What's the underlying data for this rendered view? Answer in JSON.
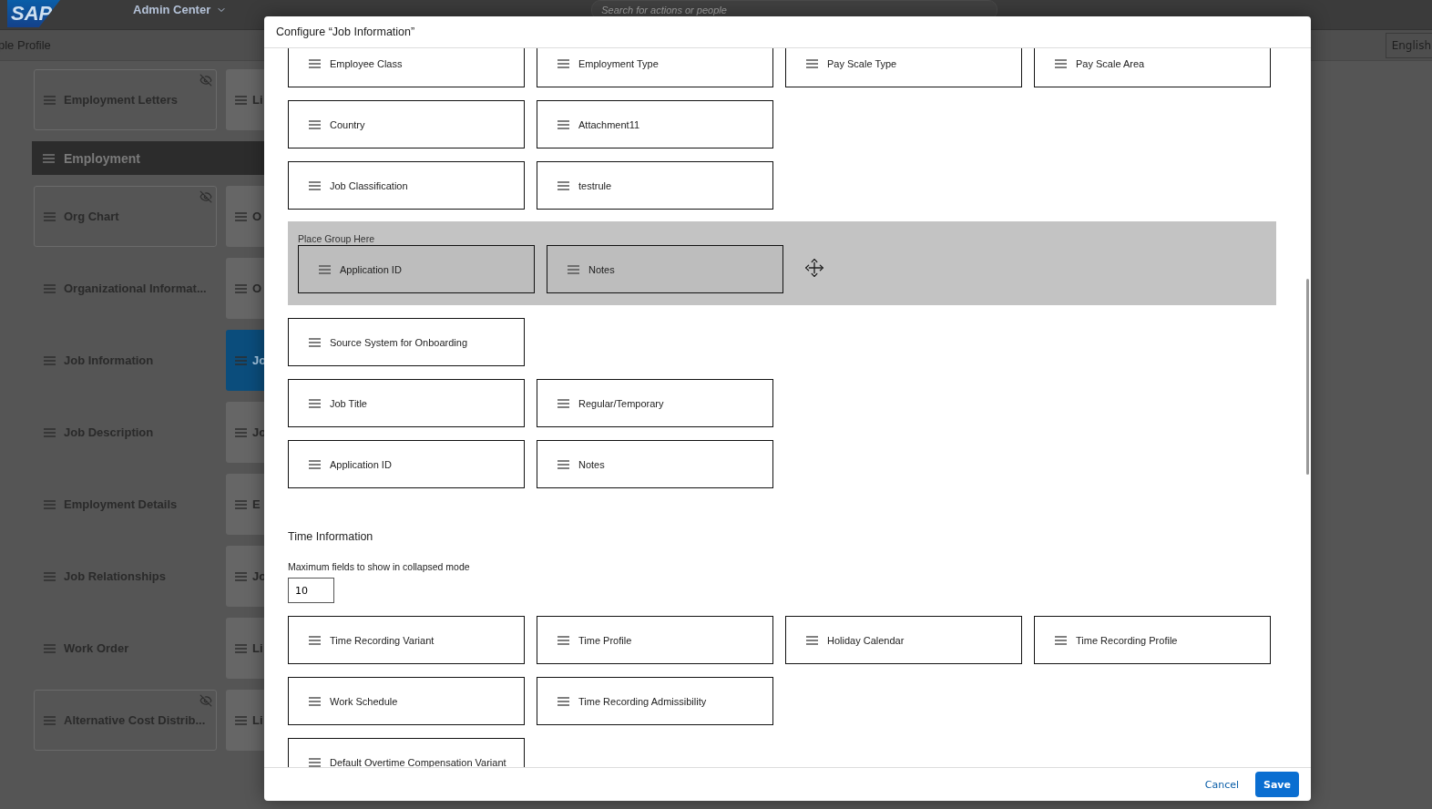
{
  "header": {
    "logo": "SAP",
    "app_title": "Admin Center",
    "search_placeholder": "Search for actions or people"
  },
  "subheader": {
    "title": "ple Profile",
    "language": "English"
  },
  "background_rows": [
    {
      "kind": "cards",
      "left": {
        "label": "Employment Letters",
        "hidden": true
      },
      "right": {
        "label": "Li",
        "selected": false
      }
    },
    {
      "kind": "section",
      "label": "Employment"
    },
    {
      "kind": "cards",
      "left": {
        "label": "Org Chart",
        "hidden": true
      },
      "right": {
        "label": "O",
        "selected": false
      }
    },
    {
      "kind": "cards",
      "left": {
        "label": "Organizational Informat...",
        "hidden": false
      },
      "right": {
        "label": "O",
        "selected": false
      }
    },
    {
      "kind": "cards",
      "left": {
        "label": "Job Information",
        "hidden": false
      },
      "right": {
        "label": "Jo",
        "selected": true
      }
    },
    {
      "kind": "cards",
      "left": {
        "label": "Job Description",
        "hidden": false
      },
      "right": {
        "label": "Jo",
        "selected": false
      }
    },
    {
      "kind": "cards",
      "left": {
        "label": "Employment Details",
        "hidden": false
      },
      "right": {
        "label": "E",
        "selected": false
      }
    },
    {
      "kind": "cards",
      "left": {
        "label": "Job Relationships",
        "hidden": false
      },
      "right": {
        "label": "Jo",
        "selected": false
      }
    },
    {
      "kind": "cards",
      "left": {
        "label": "Work Order",
        "hidden": false
      },
      "right": {
        "label": "Li",
        "selected": false
      }
    },
    {
      "kind": "cards",
      "left": {
        "label": "Alternative Cost Distrib...",
        "hidden": true
      },
      "right": {
        "label": "Li",
        "selected": false
      }
    }
  ],
  "dialog": {
    "title": "Configure “Job Information”",
    "blocks": [
      {
        "kind": "row",
        "fields": [
          "Employee Class",
          "Employment Type",
          "Pay Scale Type",
          "Pay Scale Area"
        ]
      },
      {
        "kind": "row",
        "fields": [
          "Country",
          "Attachment11"
        ]
      },
      {
        "kind": "row",
        "fields": [
          "Job Classification",
          "testrule"
        ]
      },
      {
        "kind": "dropzone",
        "label": "Place Group Here",
        "fields": [
          "Application ID",
          "Notes"
        ]
      },
      {
        "kind": "row",
        "fields": [
          "Source System for Onboarding"
        ]
      },
      {
        "kind": "row",
        "fields": [
          "Job Title",
          "Regular/Temporary"
        ]
      },
      {
        "kind": "row",
        "fields": [
          "Application ID",
          "Notes"
        ]
      },
      {
        "kind": "heading",
        "label": "Time Information"
      },
      {
        "kind": "max_fields",
        "label": "Maximum fields to show in collapsed mode",
        "value": "10"
      },
      {
        "kind": "row",
        "fields": [
          "Time Recording Variant",
          "Time Profile",
          "Holiday Calendar",
          "Time Recording Profile"
        ]
      },
      {
        "kind": "row",
        "fields": [
          "Work Schedule",
          "Time Recording Admissibility"
        ]
      },
      {
        "kind": "row",
        "fields": [
          "Default Overtime Compensation Variant"
        ]
      }
    ],
    "buttons": {
      "cancel": "Cancel",
      "save": "Save"
    }
  }
}
